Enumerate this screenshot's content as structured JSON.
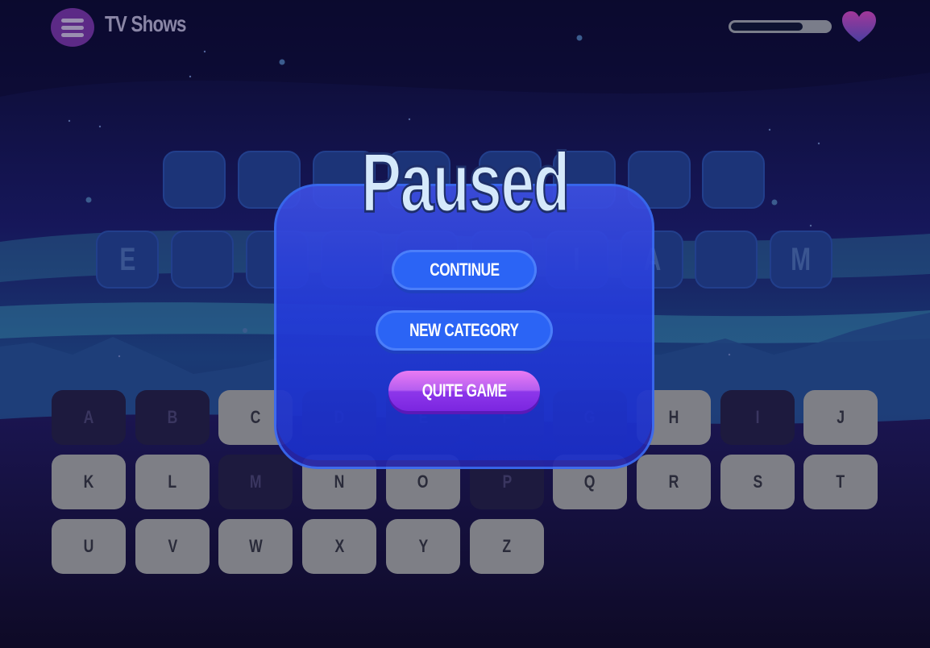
{
  "header": {
    "menu_icon": "hamburger-menu-icon",
    "category_title": "TV Shows",
    "health_fraction": 0.73,
    "life_icon": "heart-icon"
  },
  "word_tiles": {
    "row1": [
      "",
      "",
      "",
      "",
      "",
      "",
      "",
      ""
    ],
    "row2": [
      "E",
      "",
      "",
      "",
      "",
      "",
      "I",
      "A",
      "",
      "M"
    ]
  },
  "keyboard": {
    "rows": [
      [
        "A",
        "B",
        "C",
        "D",
        "E",
        "F",
        "G",
        "H",
        "I",
        "J"
      ],
      [
        "K",
        "L",
        "M",
        "N",
        "O",
        "P",
        "Q",
        "R",
        "S",
        "T"
      ],
      [
        "U",
        "V",
        "W",
        "X",
        "Y",
        "Z"
      ]
    ],
    "used_letters": [
      "A",
      "B",
      "D",
      "E",
      "F",
      "G",
      "I",
      "M",
      "P"
    ]
  },
  "pause_menu": {
    "title": "Paused",
    "continue_label": "CONTINUE",
    "new_category_label": "NEW CATEGORY",
    "quit_label": "QUITE GAME"
  },
  "colors": {
    "panel": "#233bd8",
    "button_blue": "#2b64f5",
    "button_purple": "#8d37ea",
    "heart_top": "#a1379a",
    "heart_bottom": "#4b3fa0"
  }
}
